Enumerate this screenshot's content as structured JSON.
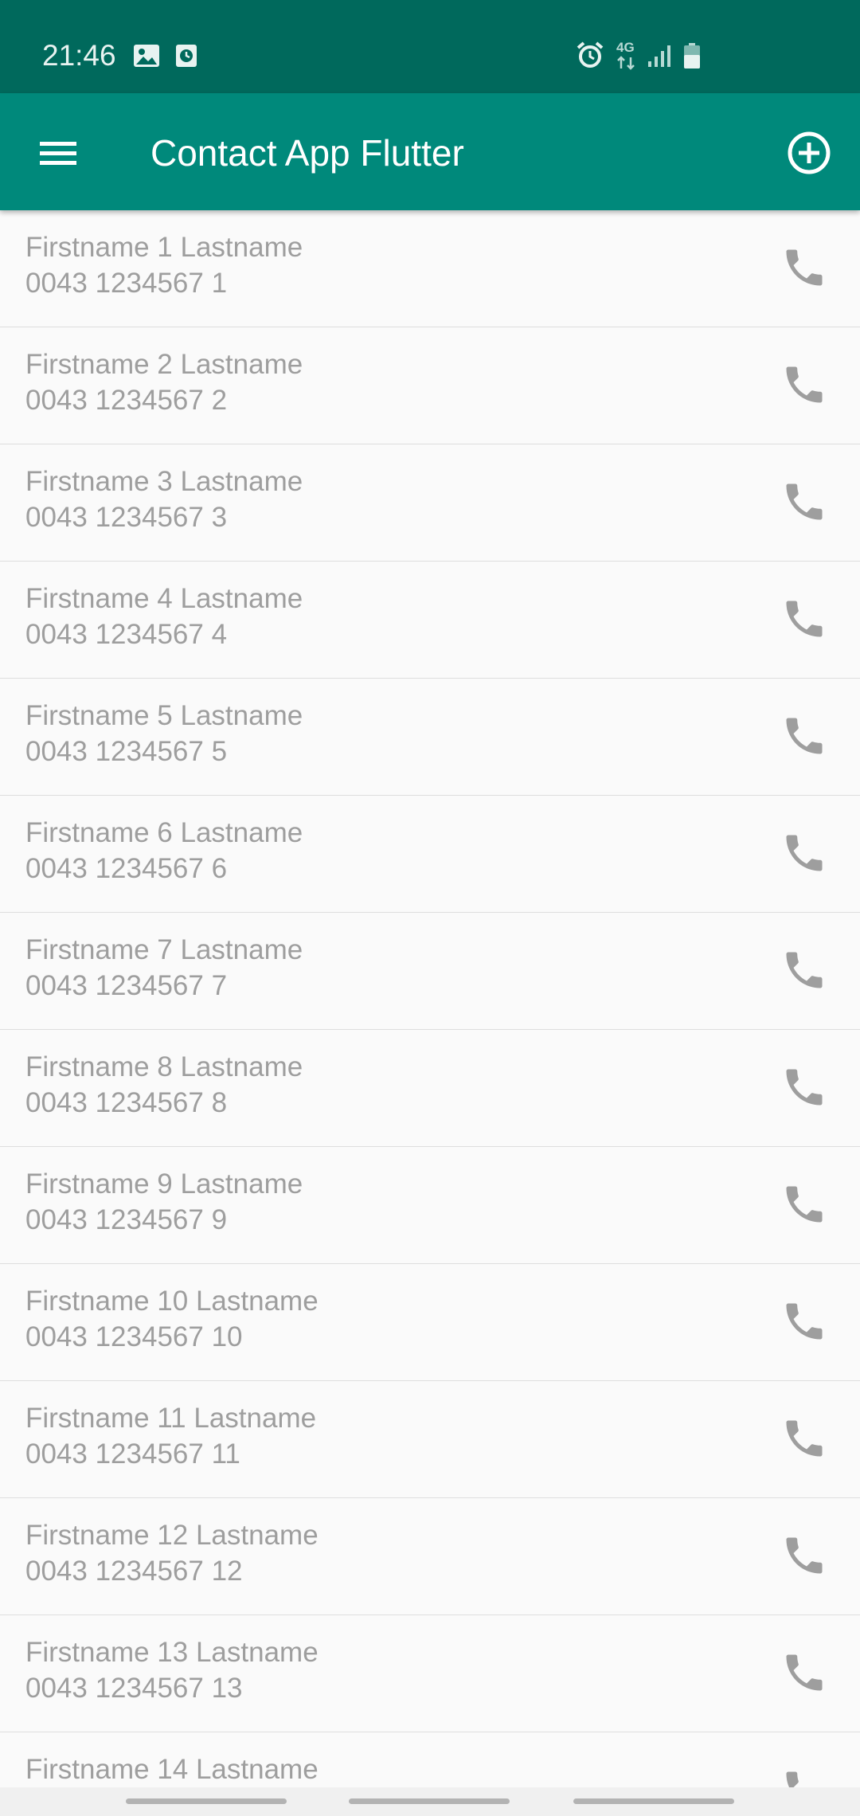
{
  "status_bar": {
    "time": "21:46",
    "network_label": "4G",
    "icons": [
      "gallery-icon",
      "clock-icon",
      "alarm-icon",
      "network-4g-icon",
      "signal-icon",
      "battery-icon"
    ]
  },
  "app_bar": {
    "title": "Contact App Flutter",
    "menu_icon": "menu-icon",
    "add_icon": "add-circle-icon"
  },
  "colors": {
    "status_bar": "#00695c",
    "app_bar": "#00897b",
    "text_secondary": "#9e9e9e",
    "icon_gray": "#9e9e9e",
    "background": "#fafafa",
    "divider": "#dedede"
  },
  "contacts": [
    {
      "name": "Firstname 1 Lastname",
      "phone": "0043 1234567 1"
    },
    {
      "name": "Firstname 2 Lastname",
      "phone": "0043 1234567 2"
    },
    {
      "name": "Firstname 3 Lastname",
      "phone": "0043 1234567 3"
    },
    {
      "name": "Firstname 4 Lastname",
      "phone": "0043 1234567 4"
    },
    {
      "name": "Firstname 5 Lastname",
      "phone": "0043 1234567 5"
    },
    {
      "name": "Firstname 6 Lastname",
      "phone": "0043 1234567 6"
    },
    {
      "name": "Firstname 7 Lastname",
      "phone": "0043 1234567 7"
    },
    {
      "name": "Firstname 8 Lastname",
      "phone": "0043 1234567 8"
    },
    {
      "name": "Firstname 9 Lastname",
      "phone": "0043 1234567 9"
    },
    {
      "name": "Firstname 10 Lastname",
      "phone": "0043 1234567 10"
    },
    {
      "name": "Firstname 11 Lastname",
      "phone": "0043 1234567 11"
    },
    {
      "name": "Firstname 12 Lastname",
      "phone": "0043 1234567 12"
    },
    {
      "name": "Firstname 13 Lastname",
      "phone": "0043 1234567 13"
    },
    {
      "name": "Firstname 14 Lastname",
      "phone": ""
    }
  ],
  "call_icon": "phone-icon"
}
